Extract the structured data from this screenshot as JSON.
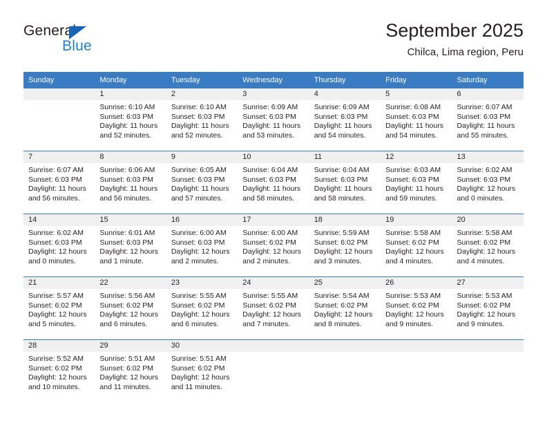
{
  "brand": {
    "name_part1": "General",
    "name_part2": "Blue",
    "accent_color": "#1e7fd4",
    "triangle_color": "#1565b8"
  },
  "header": {
    "title": "September 2025",
    "subtitle": "Chilca, Lima region, Peru"
  },
  "theme": {
    "header_row_bg": "#3a7cc4",
    "daynum_band_bg": "#f0f0f0",
    "text_color": "#231f20"
  },
  "weekday_headers": [
    "Sunday",
    "Monday",
    "Tuesday",
    "Wednesday",
    "Thursday",
    "Friday",
    "Saturday"
  ],
  "weeks": [
    [
      {
        "day": "",
        "sunrise": "",
        "sunset": "",
        "daylight": "",
        "empty": true
      },
      {
        "day": "1",
        "sunrise": "Sunrise: 6:10 AM",
        "sunset": "Sunset: 6:03 PM",
        "daylight_line1": "Daylight: 11 hours",
        "daylight_line2": "and 52 minutes."
      },
      {
        "day": "2",
        "sunrise": "Sunrise: 6:10 AM",
        "sunset": "Sunset: 6:03 PM",
        "daylight_line1": "Daylight: 11 hours",
        "daylight_line2": "and 52 minutes."
      },
      {
        "day": "3",
        "sunrise": "Sunrise: 6:09 AM",
        "sunset": "Sunset: 6:03 PM",
        "daylight_line1": "Daylight: 11 hours",
        "daylight_line2": "and 53 minutes."
      },
      {
        "day": "4",
        "sunrise": "Sunrise: 6:09 AM",
        "sunset": "Sunset: 6:03 PM",
        "daylight_line1": "Daylight: 11 hours",
        "daylight_line2": "and 54 minutes."
      },
      {
        "day": "5",
        "sunrise": "Sunrise: 6:08 AM",
        "sunset": "Sunset: 6:03 PM",
        "daylight_line1": "Daylight: 11 hours",
        "daylight_line2": "and 54 minutes."
      },
      {
        "day": "6",
        "sunrise": "Sunrise: 6:07 AM",
        "sunset": "Sunset: 6:03 PM",
        "daylight_line1": "Daylight: 11 hours",
        "daylight_line2": "and 55 minutes."
      }
    ],
    [
      {
        "day": "7",
        "sunrise": "Sunrise: 6:07 AM",
        "sunset": "Sunset: 6:03 PM",
        "daylight_line1": "Daylight: 11 hours",
        "daylight_line2": "and 56 minutes."
      },
      {
        "day": "8",
        "sunrise": "Sunrise: 6:06 AM",
        "sunset": "Sunset: 6:03 PM",
        "daylight_line1": "Daylight: 11 hours",
        "daylight_line2": "and 56 minutes."
      },
      {
        "day": "9",
        "sunrise": "Sunrise: 6:05 AM",
        "sunset": "Sunset: 6:03 PM",
        "daylight_line1": "Daylight: 11 hours",
        "daylight_line2": "and 57 minutes."
      },
      {
        "day": "10",
        "sunrise": "Sunrise: 6:04 AM",
        "sunset": "Sunset: 6:03 PM",
        "daylight_line1": "Daylight: 11 hours",
        "daylight_line2": "and 58 minutes."
      },
      {
        "day": "11",
        "sunrise": "Sunrise: 6:04 AM",
        "sunset": "Sunset: 6:03 PM",
        "daylight_line1": "Daylight: 11 hours",
        "daylight_line2": "and 58 minutes."
      },
      {
        "day": "12",
        "sunrise": "Sunrise: 6:03 AM",
        "sunset": "Sunset: 6:03 PM",
        "daylight_line1": "Daylight: 11 hours",
        "daylight_line2": "and 59 minutes."
      },
      {
        "day": "13",
        "sunrise": "Sunrise: 6:02 AM",
        "sunset": "Sunset: 6:03 PM",
        "daylight_line1": "Daylight: 12 hours",
        "daylight_line2": "and 0 minutes."
      }
    ],
    [
      {
        "day": "14",
        "sunrise": "Sunrise: 6:02 AM",
        "sunset": "Sunset: 6:03 PM",
        "daylight_line1": "Daylight: 12 hours",
        "daylight_line2": "and 0 minutes."
      },
      {
        "day": "15",
        "sunrise": "Sunrise: 6:01 AM",
        "sunset": "Sunset: 6:03 PM",
        "daylight_line1": "Daylight: 12 hours",
        "daylight_line2": "and 1 minute."
      },
      {
        "day": "16",
        "sunrise": "Sunrise: 6:00 AM",
        "sunset": "Sunset: 6:03 PM",
        "daylight_line1": "Daylight: 12 hours",
        "daylight_line2": "and 2 minutes."
      },
      {
        "day": "17",
        "sunrise": "Sunrise: 6:00 AM",
        "sunset": "Sunset: 6:02 PM",
        "daylight_line1": "Daylight: 12 hours",
        "daylight_line2": "and 2 minutes."
      },
      {
        "day": "18",
        "sunrise": "Sunrise: 5:59 AM",
        "sunset": "Sunset: 6:02 PM",
        "daylight_line1": "Daylight: 12 hours",
        "daylight_line2": "and 3 minutes."
      },
      {
        "day": "19",
        "sunrise": "Sunrise: 5:58 AM",
        "sunset": "Sunset: 6:02 PM",
        "daylight_line1": "Daylight: 12 hours",
        "daylight_line2": "and 4 minutes."
      },
      {
        "day": "20",
        "sunrise": "Sunrise: 5:58 AM",
        "sunset": "Sunset: 6:02 PM",
        "daylight_line1": "Daylight: 12 hours",
        "daylight_line2": "and 4 minutes."
      }
    ],
    [
      {
        "day": "21",
        "sunrise": "Sunrise: 5:57 AM",
        "sunset": "Sunset: 6:02 PM",
        "daylight_line1": "Daylight: 12 hours",
        "daylight_line2": "and 5 minutes."
      },
      {
        "day": "22",
        "sunrise": "Sunrise: 5:56 AM",
        "sunset": "Sunset: 6:02 PM",
        "daylight_line1": "Daylight: 12 hours",
        "daylight_line2": "and 6 minutes."
      },
      {
        "day": "23",
        "sunrise": "Sunrise: 5:55 AM",
        "sunset": "Sunset: 6:02 PM",
        "daylight_line1": "Daylight: 12 hours",
        "daylight_line2": "and 6 minutes."
      },
      {
        "day": "24",
        "sunrise": "Sunrise: 5:55 AM",
        "sunset": "Sunset: 6:02 PM",
        "daylight_line1": "Daylight: 12 hours",
        "daylight_line2": "and 7 minutes."
      },
      {
        "day": "25",
        "sunrise": "Sunrise: 5:54 AM",
        "sunset": "Sunset: 6:02 PM",
        "daylight_line1": "Daylight: 12 hours",
        "daylight_line2": "and 8 minutes."
      },
      {
        "day": "26",
        "sunrise": "Sunrise: 5:53 AM",
        "sunset": "Sunset: 6:02 PM",
        "daylight_line1": "Daylight: 12 hours",
        "daylight_line2": "and 9 minutes."
      },
      {
        "day": "27",
        "sunrise": "Sunrise: 5:53 AM",
        "sunset": "Sunset: 6:02 PM",
        "daylight_line1": "Daylight: 12 hours",
        "daylight_line2": "and 9 minutes."
      }
    ],
    [
      {
        "day": "28",
        "sunrise": "Sunrise: 5:52 AM",
        "sunset": "Sunset: 6:02 PM",
        "daylight_line1": "Daylight: 12 hours",
        "daylight_line2": "and 10 minutes."
      },
      {
        "day": "29",
        "sunrise": "Sunrise: 5:51 AM",
        "sunset": "Sunset: 6:02 PM",
        "daylight_line1": "Daylight: 12 hours",
        "daylight_line2": "and 11 minutes."
      },
      {
        "day": "30",
        "sunrise": "Sunrise: 5:51 AM",
        "sunset": "Sunset: 6:02 PM",
        "daylight_line1": "Daylight: 12 hours",
        "daylight_line2": "and 11 minutes."
      },
      {
        "day": "",
        "sunrise": "",
        "sunset": "",
        "daylight": "",
        "empty": true
      },
      {
        "day": "",
        "sunrise": "",
        "sunset": "",
        "daylight": "",
        "empty": true
      },
      {
        "day": "",
        "sunrise": "",
        "sunset": "",
        "daylight": "",
        "empty": true
      },
      {
        "day": "",
        "sunrise": "",
        "sunset": "",
        "daylight": "",
        "empty": true
      }
    ]
  ]
}
